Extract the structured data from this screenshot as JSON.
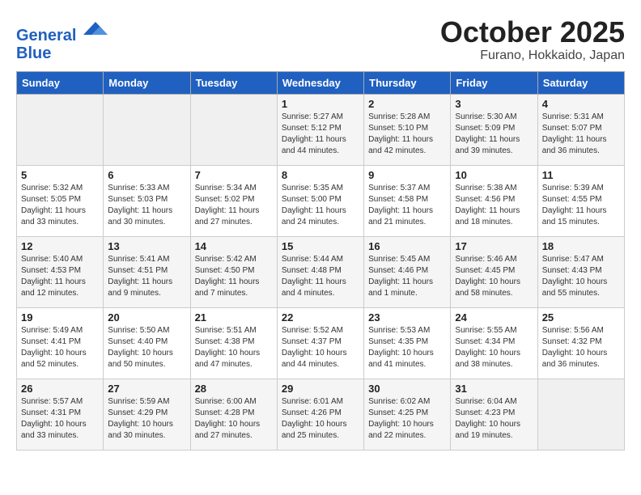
{
  "header": {
    "logo_line1": "General",
    "logo_line2": "Blue",
    "month": "October 2025",
    "location": "Furano, Hokkaido, Japan"
  },
  "weekdays": [
    "Sunday",
    "Monday",
    "Tuesday",
    "Wednesday",
    "Thursday",
    "Friday",
    "Saturday"
  ],
  "weeks": [
    [
      {
        "day": "",
        "info": ""
      },
      {
        "day": "",
        "info": ""
      },
      {
        "day": "",
        "info": ""
      },
      {
        "day": "1",
        "info": "Sunrise: 5:27 AM\nSunset: 5:12 PM\nDaylight: 11 hours\nand 44 minutes."
      },
      {
        "day": "2",
        "info": "Sunrise: 5:28 AM\nSunset: 5:10 PM\nDaylight: 11 hours\nand 42 minutes."
      },
      {
        "day": "3",
        "info": "Sunrise: 5:30 AM\nSunset: 5:09 PM\nDaylight: 11 hours\nand 39 minutes."
      },
      {
        "day": "4",
        "info": "Sunrise: 5:31 AM\nSunset: 5:07 PM\nDaylight: 11 hours\nand 36 minutes."
      }
    ],
    [
      {
        "day": "5",
        "info": "Sunrise: 5:32 AM\nSunset: 5:05 PM\nDaylight: 11 hours\nand 33 minutes."
      },
      {
        "day": "6",
        "info": "Sunrise: 5:33 AM\nSunset: 5:03 PM\nDaylight: 11 hours\nand 30 minutes."
      },
      {
        "day": "7",
        "info": "Sunrise: 5:34 AM\nSunset: 5:02 PM\nDaylight: 11 hours\nand 27 minutes."
      },
      {
        "day": "8",
        "info": "Sunrise: 5:35 AM\nSunset: 5:00 PM\nDaylight: 11 hours\nand 24 minutes."
      },
      {
        "day": "9",
        "info": "Sunrise: 5:37 AM\nSunset: 4:58 PM\nDaylight: 11 hours\nand 21 minutes."
      },
      {
        "day": "10",
        "info": "Sunrise: 5:38 AM\nSunset: 4:56 PM\nDaylight: 11 hours\nand 18 minutes."
      },
      {
        "day": "11",
        "info": "Sunrise: 5:39 AM\nSunset: 4:55 PM\nDaylight: 11 hours\nand 15 minutes."
      }
    ],
    [
      {
        "day": "12",
        "info": "Sunrise: 5:40 AM\nSunset: 4:53 PM\nDaylight: 11 hours\nand 12 minutes."
      },
      {
        "day": "13",
        "info": "Sunrise: 5:41 AM\nSunset: 4:51 PM\nDaylight: 11 hours\nand 9 minutes."
      },
      {
        "day": "14",
        "info": "Sunrise: 5:42 AM\nSunset: 4:50 PM\nDaylight: 11 hours\nand 7 minutes."
      },
      {
        "day": "15",
        "info": "Sunrise: 5:44 AM\nSunset: 4:48 PM\nDaylight: 11 hours\nand 4 minutes."
      },
      {
        "day": "16",
        "info": "Sunrise: 5:45 AM\nSunset: 4:46 PM\nDaylight: 11 hours\nand 1 minute."
      },
      {
        "day": "17",
        "info": "Sunrise: 5:46 AM\nSunset: 4:45 PM\nDaylight: 10 hours\nand 58 minutes."
      },
      {
        "day": "18",
        "info": "Sunrise: 5:47 AM\nSunset: 4:43 PM\nDaylight: 10 hours\nand 55 minutes."
      }
    ],
    [
      {
        "day": "19",
        "info": "Sunrise: 5:49 AM\nSunset: 4:41 PM\nDaylight: 10 hours\nand 52 minutes."
      },
      {
        "day": "20",
        "info": "Sunrise: 5:50 AM\nSunset: 4:40 PM\nDaylight: 10 hours\nand 50 minutes."
      },
      {
        "day": "21",
        "info": "Sunrise: 5:51 AM\nSunset: 4:38 PM\nDaylight: 10 hours\nand 47 minutes."
      },
      {
        "day": "22",
        "info": "Sunrise: 5:52 AM\nSunset: 4:37 PM\nDaylight: 10 hours\nand 44 minutes."
      },
      {
        "day": "23",
        "info": "Sunrise: 5:53 AM\nSunset: 4:35 PM\nDaylight: 10 hours\nand 41 minutes."
      },
      {
        "day": "24",
        "info": "Sunrise: 5:55 AM\nSunset: 4:34 PM\nDaylight: 10 hours\nand 38 minutes."
      },
      {
        "day": "25",
        "info": "Sunrise: 5:56 AM\nSunset: 4:32 PM\nDaylight: 10 hours\nand 36 minutes."
      }
    ],
    [
      {
        "day": "26",
        "info": "Sunrise: 5:57 AM\nSunset: 4:31 PM\nDaylight: 10 hours\nand 33 minutes."
      },
      {
        "day": "27",
        "info": "Sunrise: 5:59 AM\nSunset: 4:29 PM\nDaylight: 10 hours\nand 30 minutes."
      },
      {
        "day": "28",
        "info": "Sunrise: 6:00 AM\nSunset: 4:28 PM\nDaylight: 10 hours\nand 27 minutes."
      },
      {
        "day": "29",
        "info": "Sunrise: 6:01 AM\nSunset: 4:26 PM\nDaylight: 10 hours\nand 25 minutes."
      },
      {
        "day": "30",
        "info": "Sunrise: 6:02 AM\nSunset: 4:25 PM\nDaylight: 10 hours\nand 22 minutes."
      },
      {
        "day": "31",
        "info": "Sunrise: 6:04 AM\nSunset: 4:23 PM\nDaylight: 10 hours\nand 19 minutes."
      },
      {
        "day": "",
        "info": ""
      }
    ]
  ]
}
